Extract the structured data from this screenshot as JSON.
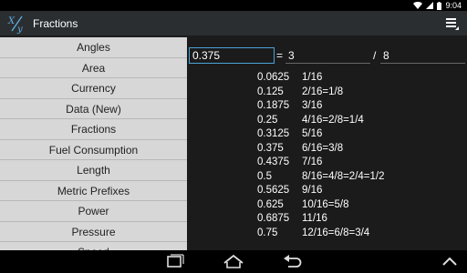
{
  "status_bar": {
    "time": "9:04"
  },
  "action_bar": {
    "title": "Fractions",
    "icon_label": "X/y"
  },
  "sidebar": {
    "items": [
      {
        "label": "Angles"
      },
      {
        "label": "Area"
      },
      {
        "label": "Currency"
      },
      {
        "label": "Data (New)"
      },
      {
        "label": "Fractions"
      },
      {
        "label": "Fuel Consumption"
      },
      {
        "label": "Length"
      },
      {
        "label": "Metric Prefixes"
      },
      {
        "label": "Power"
      },
      {
        "label": "Pressure"
      },
      {
        "label": "Speed"
      }
    ]
  },
  "calculator": {
    "decimal_value": "0.375",
    "equals": "=",
    "numerator": "3",
    "slash": "/",
    "denominator": "8"
  },
  "fraction_table": [
    {
      "decimal": "0.0625",
      "fraction": "1/16"
    },
    {
      "decimal": "0.125",
      "fraction": "2/16=1/8"
    },
    {
      "decimal": "0.1875",
      "fraction": "3/16"
    },
    {
      "decimal": "0.25",
      "fraction": "4/16=2/8=1/4"
    },
    {
      "decimal": "0.3125",
      "fraction": "5/16"
    },
    {
      "decimal": "0.375",
      "fraction": "6/16=3/8"
    },
    {
      "decimal": "0.4375",
      "fraction": "7/16"
    },
    {
      "decimal": "0.5",
      "fraction": "8/16=4/8=2/4=1/2"
    },
    {
      "decimal": "0.5625",
      "fraction": "9/16"
    },
    {
      "decimal": "0.625",
      "fraction": "10/16=5/8"
    },
    {
      "decimal": "0.6875",
      "fraction": "11/16"
    },
    {
      "decimal": "0.75",
      "fraction": "12/16=6/8=3/4"
    }
  ],
  "icons": {
    "app": "fraction-app-icon",
    "menu": "overflow-menu-icon",
    "wifi": "wifi-icon",
    "signal": "signal-icon",
    "battery": "battery-icon",
    "recent": "recent-apps-icon",
    "home": "home-icon",
    "back": "back-icon",
    "up": "chevron-up-icon"
  },
  "colors": {
    "action_bar": "#2b2e31",
    "sidebar": "#d7d7d7",
    "main": "#1b1b1b",
    "input_accent": "#4aa3d8"
  }
}
